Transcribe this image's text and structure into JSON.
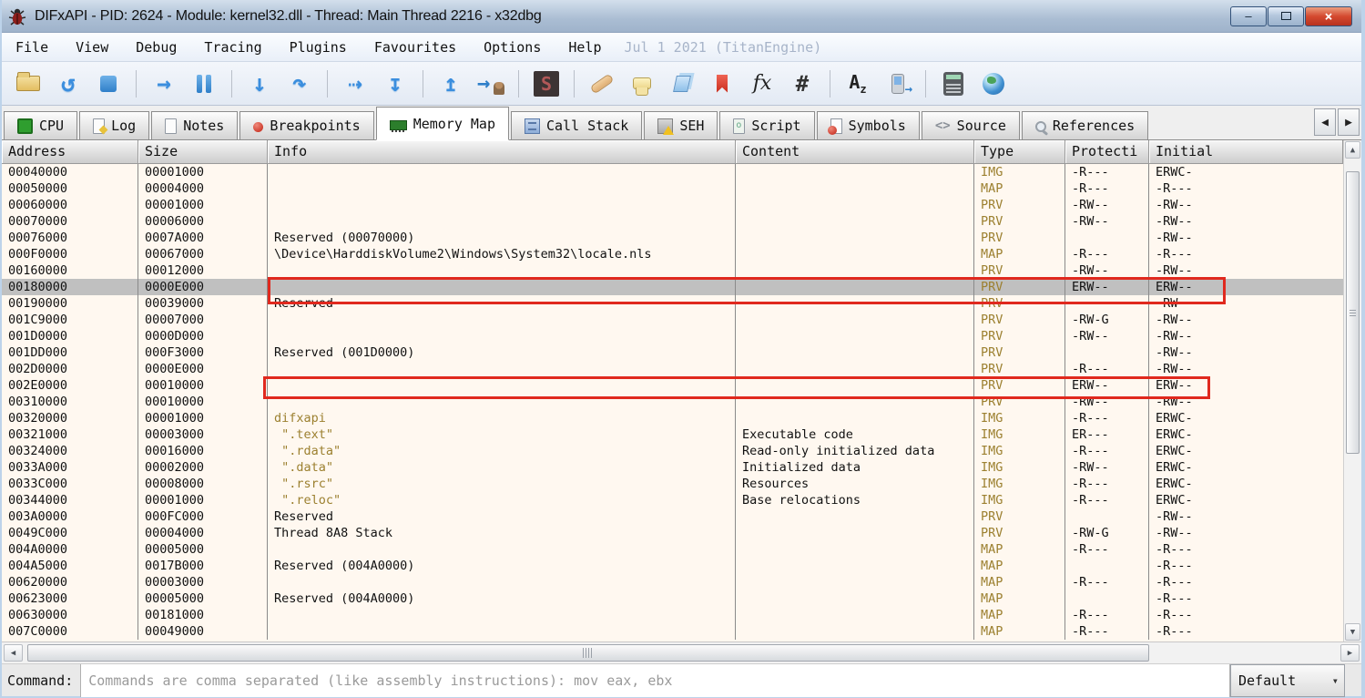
{
  "window": {
    "title": "DIFxAPI - PID: 2624 - Module: kernel32.dll - Thread: Main Thread 2216 - x32dbg",
    "controls": [
      {
        "name": "minimize-button",
        "glyph": "—"
      },
      {
        "name": "maximize-button",
        "glyph": "❐"
      },
      {
        "name": "close-button",
        "glyph": "×"
      }
    ]
  },
  "menu": {
    "items": [
      "File",
      "View",
      "Debug",
      "Tracing",
      "Plugins",
      "Favourites",
      "Options",
      "Help"
    ],
    "build_info": "Jul 1 2021 (TitanEngine)"
  },
  "toolbar": {
    "buttons": [
      {
        "name": "open-file-button",
        "icon": "folder"
      },
      {
        "name": "restart-button",
        "glyph": "↺",
        "cls": "g-blue"
      },
      {
        "name": "stop-button",
        "icon": "sq"
      },
      {
        "sep": true
      },
      {
        "name": "run-button",
        "glyph": "→",
        "cls": "g-blue"
      },
      {
        "name": "pause-button",
        "icon": "pause"
      },
      {
        "sep": true
      },
      {
        "name": "step-into-button",
        "glyph": "↓",
        "cls": "g-blue"
      },
      {
        "name": "step-over-button",
        "glyph": "↷",
        "cls": "g-blue"
      },
      {
        "sep": true
      },
      {
        "name": "animate-over-button",
        "glyph": "⇢",
        "cls": "g-blue"
      },
      {
        "name": "step-out-button",
        "glyph": "↧",
        "cls": "g-blue"
      },
      {
        "sep": true
      },
      {
        "name": "execute-till-return-button",
        "glyph": "↥",
        "cls": "g-blue"
      },
      {
        "name": "run-to-user-code-button",
        "icon": "runuser"
      },
      {
        "sep": true
      },
      {
        "name": "trace-record-button",
        "icon": "trace",
        "glyph": "S"
      },
      {
        "sep": true
      },
      {
        "name": "patches-button",
        "icon": "bandaid"
      },
      {
        "name": "comments-button",
        "icon": "bubble"
      },
      {
        "name": "labels-button",
        "icon": "tags"
      },
      {
        "name": "bookmarks-button",
        "icon": "bookmark"
      },
      {
        "name": "functions-button",
        "glyph": "fx",
        "cls": "g-fx"
      },
      {
        "name": "hash-button",
        "glyph": "#",
        "cls": "g-dark"
      },
      {
        "sep": true
      },
      {
        "name": "case-button",
        "icon": "az"
      },
      {
        "name": "phone-forward-button",
        "icon": "phone"
      },
      {
        "sep": true
      },
      {
        "name": "calculator-button",
        "icon": "calc"
      },
      {
        "name": "globe-button",
        "icon": "globe"
      }
    ]
  },
  "tabs": [
    {
      "label": "CPU",
      "icon": "cpu-icon",
      "active": false
    },
    {
      "label": "Log",
      "icon": "log-icon",
      "active": false
    },
    {
      "label": "Notes",
      "icon": "notes-icon",
      "active": false
    },
    {
      "label": "Breakpoints",
      "icon": "breakpoint-icon",
      "active": false
    },
    {
      "label": "Memory Map",
      "icon": "memory-map-icon",
      "active": true
    },
    {
      "label": "Call Stack",
      "icon": "call-stack-icon",
      "active": false
    },
    {
      "label": "SEH",
      "icon": "seh-icon",
      "active": false
    },
    {
      "label": "Script",
      "icon": "script-icon",
      "active": false
    },
    {
      "label": "Symbols",
      "icon": "symbols-icon",
      "active": false
    },
    {
      "label": "Source",
      "icon": "source-icon",
      "active": false
    },
    {
      "label": "References",
      "icon": "references-icon",
      "active": false
    }
  ],
  "table": {
    "columns": [
      {
        "key": "address",
        "label": "Address"
      },
      {
        "key": "size",
        "label": "Size"
      },
      {
        "key": "info",
        "label": "Info"
      },
      {
        "key": "content",
        "label": "Content"
      },
      {
        "key": "type",
        "label": "Type"
      },
      {
        "key": "protect",
        "label": "Protecti"
      },
      {
        "key": "initial",
        "label": "Initial"
      }
    ],
    "rows": [
      {
        "address": "00040000",
        "size": "00001000",
        "info": "",
        "content": "",
        "type": "IMG",
        "protect": "-R---",
        "initial": "ERWC-"
      },
      {
        "address": "00050000",
        "size": "00004000",
        "info": "",
        "content": "",
        "type": "MAP",
        "protect": "-R---",
        "initial": "-R---"
      },
      {
        "address": "00060000",
        "size": "00001000",
        "info": "",
        "content": "",
        "type": "PRV",
        "protect": "-RW--",
        "initial": "-RW--"
      },
      {
        "address": "00070000",
        "size": "00006000",
        "info": "",
        "content": "",
        "type": "PRV",
        "protect": "-RW--",
        "initial": "-RW--"
      },
      {
        "address": "00076000",
        "size": "0007A000",
        "info": "Reserved (00070000)",
        "content": "",
        "type": "PRV",
        "protect": "",
        "initial": "-RW--"
      },
      {
        "address": "000F0000",
        "size": "00067000",
        "info": "\\Device\\HarddiskVolume2\\Windows\\System32\\locale.nls",
        "content": "",
        "type": "MAP",
        "protect": "-R---",
        "initial": "-R---"
      },
      {
        "address": "00160000",
        "size": "00012000",
        "info": "",
        "content": "",
        "type": "PRV",
        "protect": "-RW--",
        "initial": "-RW--"
      },
      {
        "address": "00180000",
        "size": "0000E000",
        "info": "",
        "content": "",
        "type": "PRV",
        "protect": "ERW--",
        "initial": "ERW--",
        "selected": true
      },
      {
        "address": "00190000",
        "size": "00039000",
        "info": "Reserved",
        "content": "",
        "type": "PRV",
        "protect": "",
        "initial": "-RW--"
      },
      {
        "address": "001C9000",
        "size": "00007000",
        "info": "",
        "content": "",
        "type": "PRV",
        "protect": "-RW-G",
        "initial": "-RW--"
      },
      {
        "address": "001D0000",
        "size": "0000D000",
        "info": "",
        "content": "",
        "type": "PRV",
        "protect": "-RW--",
        "initial": "-RW--"
      },
      {
        "address": "001DD000",
        "size": "000F3000",
        "info": "Reserved (001D0000)",
        "content": "",
        "type": "PRV",
        "protect": "",
        "initial": "-RW--"
      },
      {
        "address": "002D0000",
        "size": "0000E000",
        "info": "",
        "content": "",
        "type": "PRV",
        "protect": "-R---",
        "initial": "-RW--"
      },
      {
        "address": "002E0000",
        "size": "00010000",
        "info": "",
        "content": "",
        "type": "PRV",
        "protect": "ERW--",
        "initial": "ERW--"
      },
      {
        "address": "00310000",
        "size": "00010000",
        "info": "",
        "content": "",
        "type": "PRV",
        "protect": "-RW--",
        "initial": "-RW--"
      },
      {
        "address": "00320000",
        "size": "00001000",
        "info": "difxapi",
        "content": "",
        "type": "IMG",
        "protect": "-R---",
        "initial": "ERWC-",
        "module": true
      },
      {
        "address": "00321000",
        "size": "00003000",
        "info": " \".text\"",
        "content": "Executable code",
        "type": "IMG",
        "protect": "ER---",
        "initial": "ERWC-",
        "module": true
      },
      {
        "address": "00324000",
        "size": "00016000",
        "info": " \".rdata\"",
        "content": "Read-only initialized data",
        "type": "IMG",
        "protect": "-R---",
        "initial": "ERWC-",
        "module": true
      },
      {
        "address": "0033A000",
        "size": "00002000",
        "info": " \".data\"",
        "content": "Initialized data",
        "type": "IMG",
        "protect": "-RW--",
        "initial": "ERWC-",
        "module": true
      },
      {
        "address": "0033C000",
        "size": "00008000",
        "info": " \".rsrc\"",
        "content": "Resources",
        "type": "IMG",
        "protect": "-R---",
        "initial": "ERWC-",
        "module": true
      },
      {
        "address": "00344000",
        "size": "00001000",
        "info": " \".reloc\"",
        "content": "Base relocations",
        "type": "IMG",
        "protect": "-R---",
        "initial": "ERWC-",
        "module": true
      },
      {
        "address": "003A0000",
        "size": "000FC000",
        "info": "Reserved",
        "content": "",
        "type": "PRV",
        "protect": "",
        "initial": "-RW--"
      },
      {
        "address": "0049C000",
        "size": "00004000",
        "info": "Thread 8A8 Stack",
        "content": "",
        "type": "PRV",
        "protect": "-RW-G",
        "initial": "-RW--"
      },
      {
        "address": "004A0000",
        "size": "00005000",
        "info": "",
        "content": "",
        "type": "MAP",
        "protect": "-R---",
        "initial": "-R---"
      },
      {
        "address": "004A5000",
        "size": "0017B000",
        "info": "Reserved (004A0000)",
        "content": "",
        "type": "MAP",
        "protect": "",
        "initial": "-R---"
      },
      {
        "address": "00620000",
        "size": "00003000",
        "info": "",
        "content": "",
        "type": "MAP",
        "protect": "-R---",
        "initial": "-R---"
      },
      {
        "address": "00623000",
        "size": "00005000",
        "info": "Reserved (004A0000)",
        "content": "",
        "type": "MAP",
        "protect": "",
        "initial": "-R---"
      },
      {
        "address": "00630000",
        "size": "00181000",
        "info": "",
        "content": "",
        "type": "MAP",
        "protect": "-R---",
        "initial": "-R---"
      },
      {
        "address": "007C0000",
        "size": "00049000",
        "info": "",
        "content": "",
        "type": "MAP",
        "protect": "-R---",
        "initial": "-R---"
      }
    ]
  },
  "command_bar": {
    "label": "Command:",
    "placeholder": "Commands are comma separated (like assembly instructions): mov eax, ebx",
    "profile": "Default"
  },
  "colors": {
    "annotation_red": "#e0291e",
    "selection_gray": "#c0c0c0",
    "table_background": "#fff8f0",
    "olive_text": "#9c8030",
    "accent_blue": "#3b8ede"
  }
}
